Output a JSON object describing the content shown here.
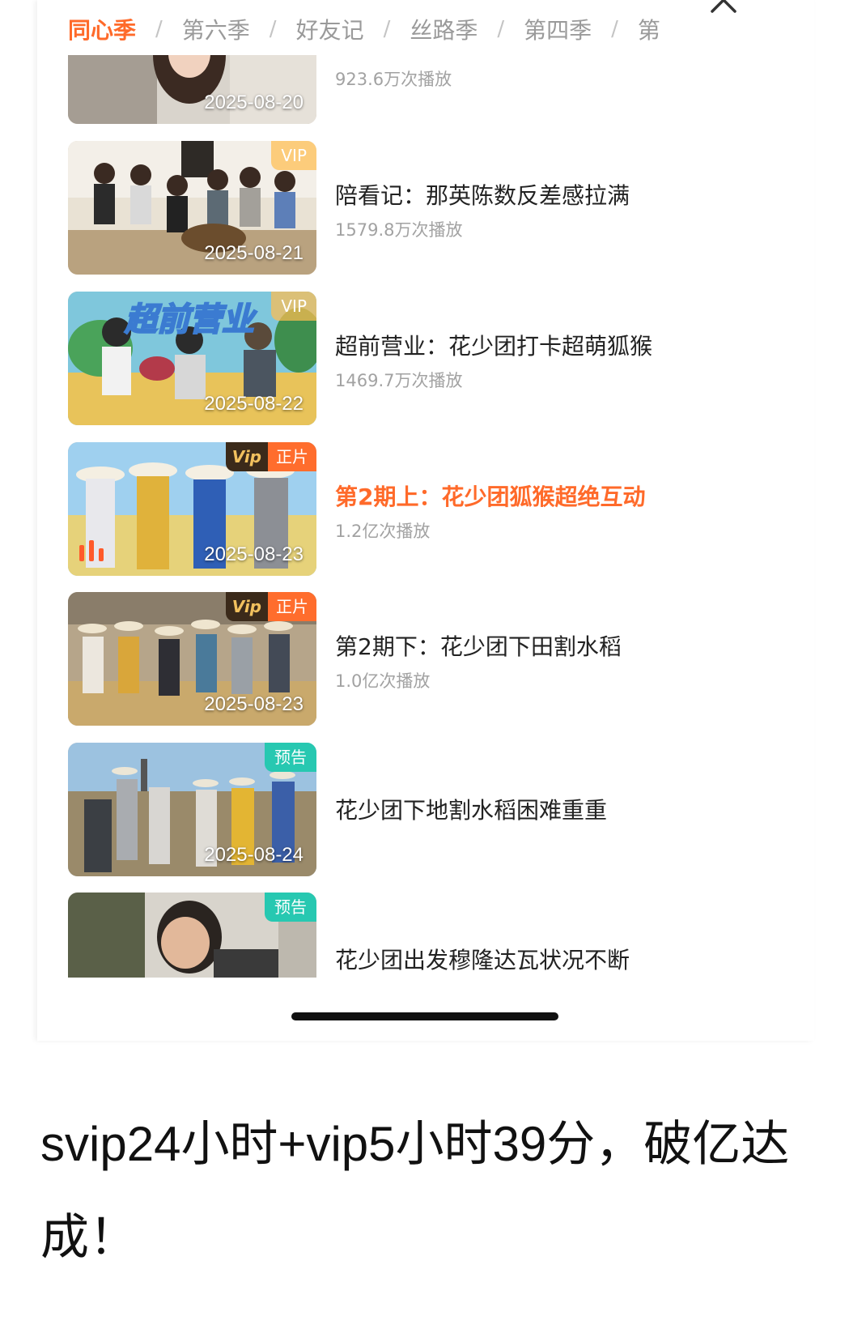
{
  "tabs": [
    "同心季",
    "第六季",
    "好友记",
    "丝路季",
    "第四季",
    "第"
  ],
  "tab_separator": "/",
  "active_tab": "同心季",
  "episodes": [
    {
      "date": "2025-08-20",
      "title": "",
      "views": "923.6万次播放",
      "badge": "",
      "current": false
    },
    {
      "date": "2025-08-21",
      "title": "陪看记：那英陈数反差感拉满",
      "views": "1579.8万次播放",
      "badge": "VIP",
      "current": false
    },
    {
      "date": "2025-08-22",
      "title": "超前营业：花少团打卡超萌狐猴",
      "views": "1469.7万次播放",
      "badge": "VIP",
      "current": false,
      "thumb_text": "超前营业"
    },
    {
      "date": "2025-08-23",
      "title": "第2期上：花少团狐猴超绝互动",
      "views": "1.2亿次播放",
      "badge_vip": "Vip",
      "badge_label": "正片",
      "current": true
    },
    {
      "date": "2025-08-23",
      "title": "第2期下：花少团下田割水稻",
      "views": "1.0亿次播放",
      "badge_vip": "Vip",
      "badge_label": "正片",
      "current": false
    },
    {
      "date": "2025-08-24",
      "title": "花少团下地割水稻困难重重",
      "views": "",
      "badge": "预告",
      "current": false
    },
    {
      "date": "",
      "title": "花少团出发穆隆达瓦状况不断",
      "views": "",
      "badge": "预告",
      "current": false
    }
  ],
  "caption": "svip24小时+vip5小时39分，破亿达成！",
  "colors": {
    "accent": "#ff6a2a",
    "trailer_badge": "#27c8b1",
    "vip_badge": "#ffbe50"
  },
  "icons": {
    "close": "close-icon",
    "playing": "now-playing-icon"
  }
}
